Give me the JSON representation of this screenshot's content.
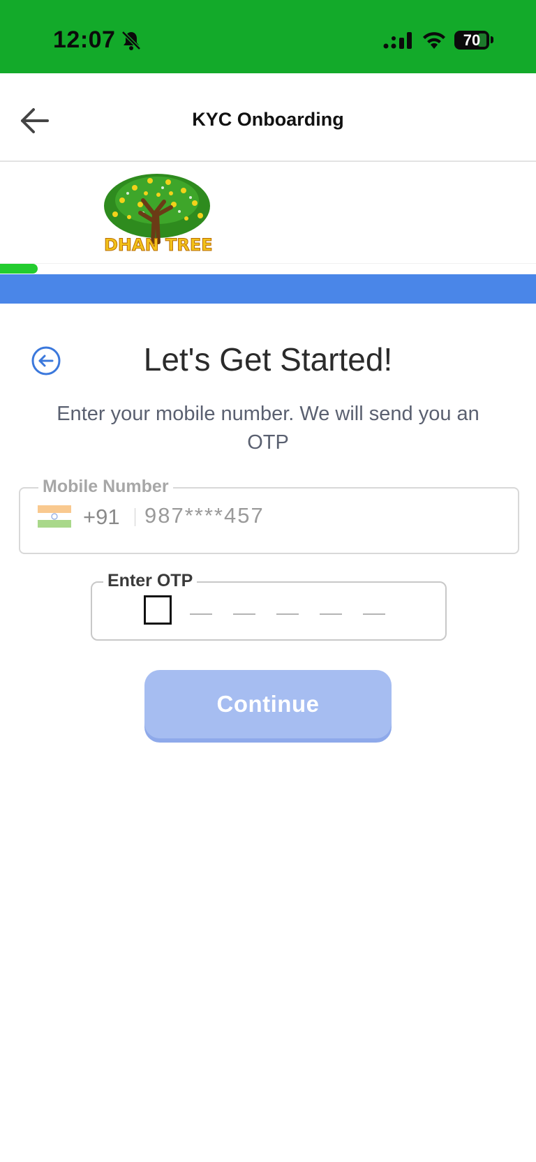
{
  "status_bar": {
    "time": "12:07",
    "battery": "70",
    "icons": [
      "bell-slash-icon",
      "signal-icon",
      "wifi-icon",
      "battery-icon"
    ]
  },
  "header": {
    "title": "KYC Onboarding",
    "back_icon": "arrow-left-icon"
  },
  "logo": {
    "text_left": "DHAN",
    "text_right": "TREE"
  },
  "progress": {
    "value_percent": 7,
    "color": "#23cc2f"
  },
  "colors": {
    "status_bar": "#13aa2a",
    "blue_band": "#4a86e8",
    "button": "#a6bdf1"
  },
  "main": {
    "title": "Let's Get Started!",
    "subtitle": "Enter your mobile number. We will send you an OTP",
    "back_icon": "arrow-left-circle-icon"
  },
  "mobile": {
    "label": "Mobile Number",
    "country_code": "+91",
    "value": "987****457",
    "flag_icon": "india-flag-icon"
  },
  "otp": {
    "label": "Enter OTP",
    "digits": 6
  },
  "continue_label": "Continue"
}
